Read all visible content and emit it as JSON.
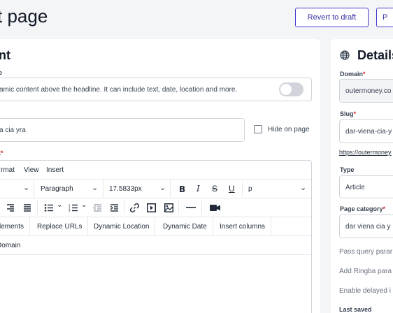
{
  "header": {
    "title": "t page",
    "revert_label": "Revert to draft",
    "publish_label": "P"
  },
  "content": {
    "heading": "nt",
    "pre_headline": {
      "label": "e",
      "value": "amic content above the headline. It can include text, date, location and more."
    },
    "title_field": {
      "value": "a cia yra",
      "hide_label": "Hide on page"
    },
    "body_label": "t",
    "editor": {
      "menu": [
        "rmat",
        "View",
        "Insert"
      ],
      "block_select": "Paragraph",
      "font_size": "17.5833px",
      "tag_select": "p",
      "custom_buttons": [
        "lements",
        "Replace URLs",
        "Dynamic Location",
        "Dynamic Date",
        "Insert columns"
      ],
      "row4_button": "Domain"
    }
  },
  "details": {
    "heading": "Details",
    "domain": {
      "label": "Domain",
      "value": "outermoney.co"
    },
    "slug": {
      "label": "Slug",
      "value": "dar-viena-cia-y"
    },
    "url": "https://outermoney",
    "type": {
      "label": "Type",
      "value": "Article"
    },
    "page_category": {
      "label": "Page category",
      "value": "dar viena cia y"
    },
    "options": [
      "Pass query parar",
      "Add Ringba para",
      "Enable delayed i"
    ],
    "last_saved_label": "Last saved"
  },
  "colors": {
    "accent": "#3730a3",
    "required": "#dc2626",
    "background": "#f4f5f7"
  },
  "icons": [
    "globe-icon",
    "bold-icon",
    "italic-icon",
    "strikethrough-icon",
    "underline-icon",
    "align-right-icon",
    "justify-icon",
    "bullet-list-icon",
    "numbered-list-icon",
    "outdent-icon",
    "indent-icon",
    "link-icon",
    "media-icon",
    "image-icon",
    "horizontal-rule-icon",
    "video-icon",
    "chevron-down-icon"
  ]
}
